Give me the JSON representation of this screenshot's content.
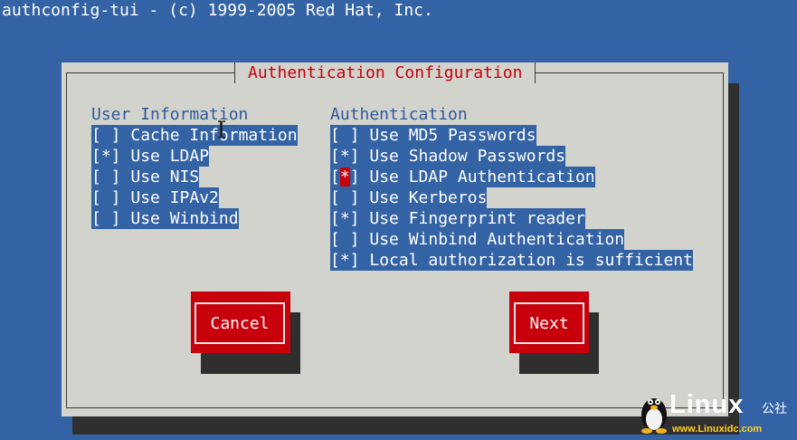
{
  "title": "authconfig-tui - (c) 1999-2005 Red Hat, Inc.",
  "dialog": {
    "title": "Authentication Configuration",
    "user_info": {
      "header": "User Information",
      "items": [
        {
          "box": "[ ]",
          "label": "Cache Information"
        },
        {
          "box": "[*]",
          "label": "Use LDAP"
        },
        {
          "box": "[ ]",
          "label": "Use NIS"
        },
        {
          "box": "[ ]",
          "label": "Use IPAv2"
        },
        {
          "box": "[ ]",
          "label": "Use Winbind"
        }
      ]
    },
    "authentication": {
      "header": "Authentication",
      "items": [
        {
          "box": "[ ]",
          "label": "Use MD5 Passwords"
        },
        {
          "box": "[*]",
          "label": "Use Shadow Passwords"
        },
        {
          "box_open": "[",
          "box_mark": "*",
          "box_close": "]",
          "label": "Use LDAP Authentication"
        },
        {
          "box": "[ ]",
          "label": "Use Kerberos"
        },
        {
          "box": "[*]",
          "label": "Use Fingerprint reader"
        },
        {
          "box": "[ ]",
          "label": "Use Winbind Authentication"
        },
        {
          "box": "[*]",
          "label": "Local authorization is sufficient"
        }
      ]
    },
    "buttons": {
      "cancel": "Cancel",
      "next": "Next"
    }
  },
  "watermark": {
    "brand": "Linux",
    "cn": "公社",
    "url": "www.Linuxidc.com"
  },
  "colors": {
    "background": "#3463a5",
    "dialog": "#d3d3cd",
    "accent_red": "#c7000c",
    "header_blue": "#2f5a9b"
  }
}
